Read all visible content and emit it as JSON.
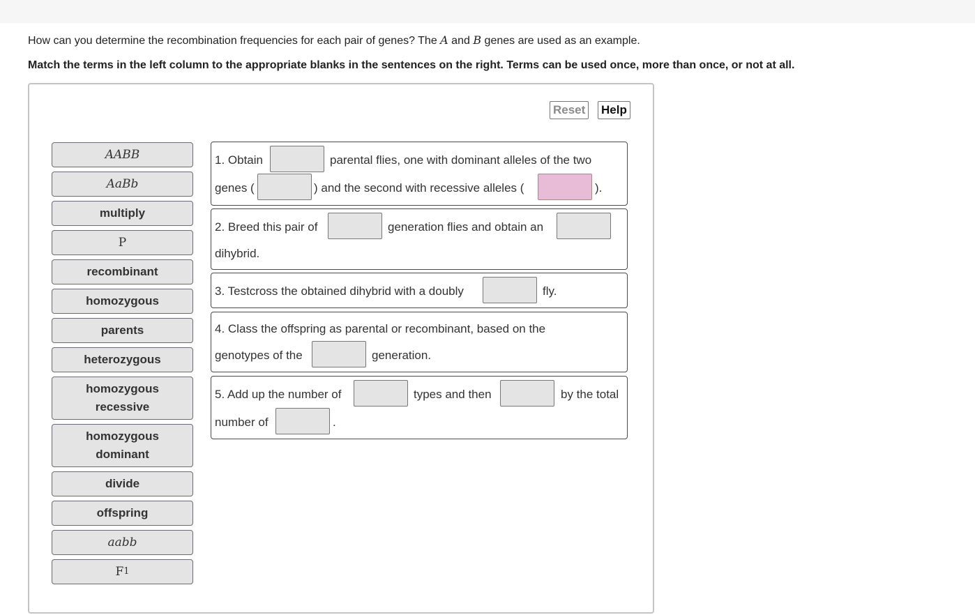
{
  "question": {
    "part1": "How can you determine the recombination frequencies for each pair of genes? The ",
    "gene_a": "A",
    "part2": " and ",
    "gene_b": "B",
    "part3": " genes are used as an example."
  },
  "instruction": "Match the terms in the left column to the appropriate blanks in the sentences on the right. Terms can be used once, more than once, or not at all.",
  "buttons": {
    "reset": "Reset",
    "help": "Help"
  },
  "terms": [
    {
      "label": "AABB",
      "style": "math"
    },
    {
      "label": "AaBb",
      "style": "math"
    },
    {
      "label": "multiply",
      "style": "text"
    },
    {
      "label": "P",
      "style": "roman"
    },
    {
      "label": "recombinant",
      "style": "text"
    },
    {
      "label": "homozygous",
      "style": "text"
    },
    {
      "label": "parents",
      "style": "text"
    },
    {
      "label": "heterozygous",
      "style": "text"
    },
    {
      "label": "homozygous recessive",
      "line1": "homozygous",
      "line2": "recessive",
      "style": "text"
    },
    {
      "label": "homozygous dominant",
      "line1": "homozygous",
      "line2": "dominant",
      "style": "text"
    },
    {
      "label": "divide",
      "style": "text"
    },
    {
      "label": "offspring",
      "style": "text"
    },
    {
      "label": "aabb",
      "style": "math"
    },
    {
      "label": "F1",
      "base": "F",
      "sub": "1",
      "style": "roman"
    }
  ],
  "sentences": [
    {
      "t1": "1. Obtain",
      "t2": "parental flies, one with dominant alleles of the two",
      "t3": "genes (",
      "t4": ") and the second with recessive alleles (",
      "t5": ")."
    },
    {
      "t1": "2. Breed this pair of",
      "t2": "generation flies and obtain an",
      "t3": "dihybrid."
    },
    {
      "t1": "3. Testcross the obtained dihybrid with a doubly",
      "t2": "fly."
    },
    {
      "t1": "4. Class the offspring as parental or recombinant, based on the",
      "t2": "genotypes of the",
      "t3": "generation."
    },
    {
      "t1": "5. Add up the number of",
      "t2": "types and then",
      "t3": "by the total",
      "t4": "number of",
      "t5": "."
    }
  ],
  "blank_states": {
    "s1_b3": "highlighted"
  },
  "colors": {
    "term_bg": "#e4e4e4",
    "blank_bg": "#e4e4e4",
    "highlight_blank": "#e8bcd6"
  }
}
